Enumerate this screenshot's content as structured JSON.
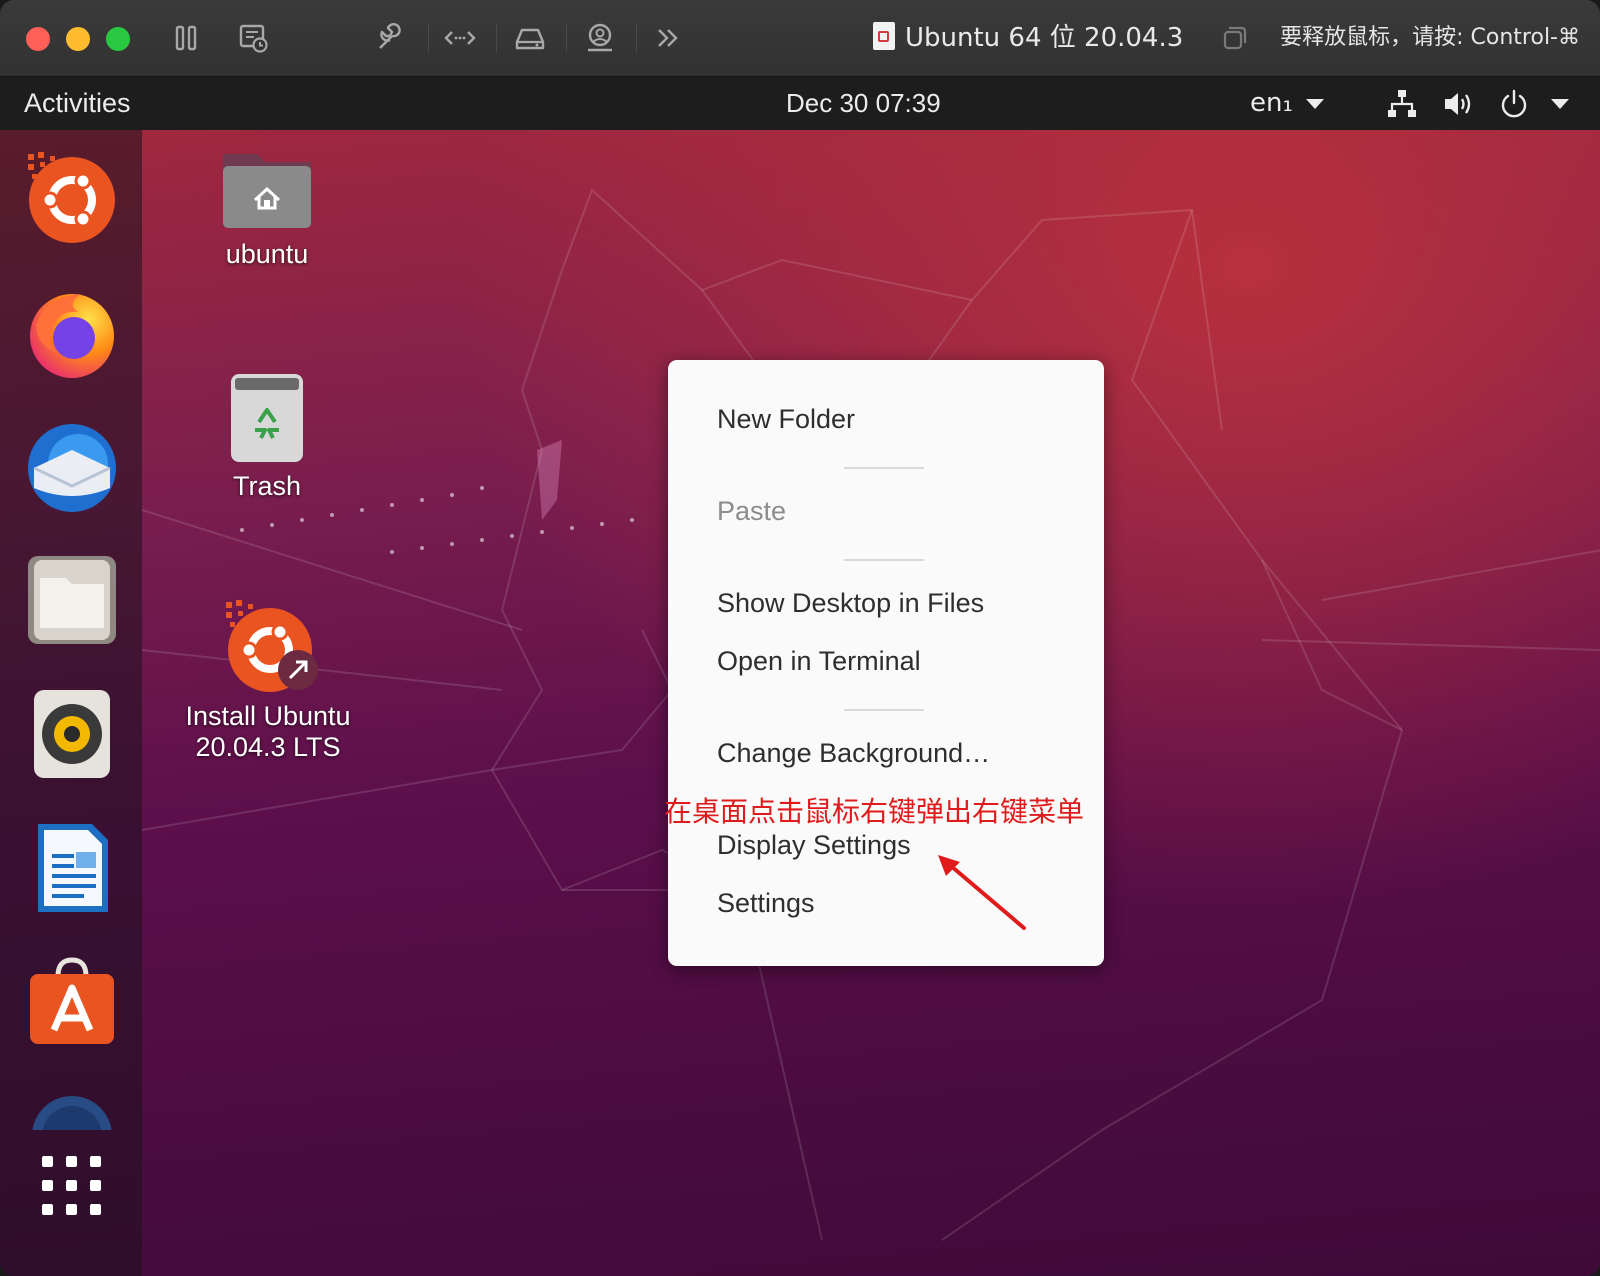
{
  "vm_toolbar": {
    "title": "Ubuntu 64 位 20.04.3",
    "hint": "要释放鼠标，请按: Control-⌘",
    "icons": [
      "pause-icon",
      "snapshot-icon",
      "settings-wrench-icon",
      "network-arrows-icon",
      "disk-icon",
      "user-icon",
      "more-chevrons-icon",
      "copy-window-icon"
    ],
    "colors": {
      "close": "#ff5f57",
      "minimize": "#febc2e",
      "zoom": "#28c840"
    }
  },
  "topbar": {
    "activities": "Activities",
    "clock": "Dec 30  07:39",
    "input_method": "en₁"
  },
  "dock": {
    "apps": [
      "ubuntu-installer",
      "firefox",
      "thunderbird",
      "files",
      "rhythmbox",
      "libreoffice-writer",
      "software-center",
      "help"
    ]
  },
  "desktop_icons": {
    "home": "ubuntu",
    "trash": "Trash",
    "install_line1": "Install Ubuntu",
    "install_line2": "20.04.3 LTS"
  },
  "context_menu": {
    "new_folder": "New Folder",
    "paste": "Paste",
    "show_desktop": "Show Desktop in Files",
    "open_terminal": "Open in Terminal",
    "change_background": "Change Background…",
    "display_settings": "Display Settings",
    "settings": "Settings"
  },
  "annotation": {
    "text": "在桌面点击鼠标右键弹出右键菜单",
    "color": "#e01b1b"
  }
}
